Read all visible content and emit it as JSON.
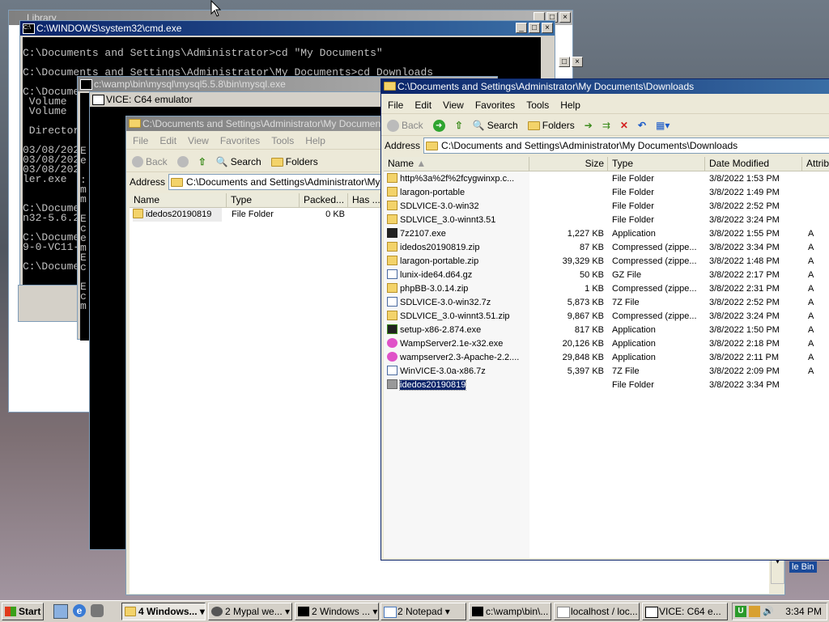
{
  "windows": {
    "library": {
      "title": "Library"
    },
    "cmd": {
      "title": "C:\\WINDOWS\\system32\\cmd.exe",
      "lines": [
        "C:\\Documents and Settings\\Administrator>cd \"My Documents\"",
        "",
        "C:\\Documents and Settings\\Administrator\\My Documents>cd Downloads",
        "",
        "C:\\Docume",
        " Volume ",
        " Volume ",
        "",
        " Director",
        "",
        "03/08/202",
        "03/08/202",
        "03/08/202",
        "ler.exe",
        "",
        "",
        "C:\\Docume",
        "n32-5.6.2",
        "",
        "C:\\Docume",
        "9-0-VC11-",
        "",
        "C:\\Docume"
      ]
    },
    "mysql": {
      "title": "c:\\wamp\\bin\\mysql\\mysql5.5.8\\bin\\mysql.exe",
      "lines": [
        "",
        "",
        "",
        "",
        "",
        "E",
        "e",
        "",
        ":",
        "m",
        "m",
        "",
        "E",
        "c",
        "e",
        "m",
        "E",
        "c",
        "",
        "E",
        "c",
        "m"
      ]
    },
    "vice": {
      "title": "VICE: C64 emulator"
    },
    "explorer_left": {
      "title": "C:\\Documents and Settings\\Administrator\\My Documents",
      "menu": [
        "File",
        "Edit",
        "View",
        "Favorites",
        "Tools",
        "Help"
      ],
      "toolbar": {
        "back": "Back",
        "search": "Search",
        "folders": "Folders"
      },
      "address_label": "Address",
      "address": "C:\\Documents and Settings\\Administrator\\My Documents",
      "columns": [
        "Name",
        "Type",
        "Packed...",
        "Has ..."
      ],
      "rows": [
        {
          "name": "idedos20190819",
          "type": "File Folder",
          "packed": "0 KB"
        }
      ]
    },
    "explorer_right": {
      "title": "C:\\Documents and Settings\\Administrator\\My Documents\\Downloads",
      "menu": [
        "File",
        "Edit",
        "View",
        "Favorites",
        "Tools",
        "Help"
      ],
      "toolbar": {
        "back": "Back",
        "search": "Search",
        "folders": "Folders"
      },
      "address_label": "Address",
      "address": "C:\\Documents and Settings\\Administrator\\My Documents\\Downloads",
      "columns": [
        "Name",
        "Size",
        "Type",
        "Date Modified",
        "Attribu"
      ],
      "rows": [
        {
          "name": "http%3a%2f%2fcygwinxp.c...",
          "size": "",
          "type": "File Folder",
          "date": "3/8/2022 1:53 PM",
          "attr": "",
          "icon": "folder"
        },
        {
          "name": "laragon-portable",
          "size": "",
          "type": "File Folder",
          "date": "3/8/2022 1:49 PM",
          "attr": "",
          "icon": "folder"
        },
        {
          "name": "SDLVICE-3.0-win32",
          "size": "",
          "type": "File Folder",
          "date": "3/8/2022 2:52 PM",
          "attr": "",
          "icon": "folder"
        },
        {
          "name": "SDLVICE_3.0-winnt3.51",
          "size": "",
          "type": "File Folder",
          "date": "3/8/2022 3:24 PM",
          "attr": "",
          "icon": "folder"
        },
        {
          "name": "7z2107.exe",
          "size": "1,227 KB",
          "type": "Application",
          "date": "3/8/2022 1:55 PM",
          "attr": "A",
          "icon": "7z"
        },
        {
          "name": "idedos20190819.zip",
          "size": "87 KB",
          "type": "Compressed (zippe...",
          "date": "3/8/2022 3:34 PM",
          "attr": "A",
          "icon": "zip"
        },
        {
          "name": "laragon-portable.zip",
          "size": "39,329 KB",
          "type": "Compressed (zippe...",
          "date": "3/8/2022 1:48 PM",
          "attr": "A",
          "icon": "zip"
        },
        {
          "name": "lunix-ide64.d64.gz",
          "size": "50 KB",
          "type": "GZ File",
          "date": "3/8/2022 2:17 PM",
          "attr": "A",
          "icon": "file"
        },
        {
          "name": "phpBB-3.0.14.zip",
          "size": "1 KB",
          "type": "Compressed (zippe...",
          "date": "3/8/2022 2:31 PM",
          "attr": "A",
          "icon": "zip"
        },
        {
          "name": "SDLVICE-3.0-win32.7z",
          "size": "5,873 KB",
          "type": "7Z File",
          "date": "3/8/2022 2:52 PM",
          "attr": "A",
          "icon": "file"
        },
        {
          "name": "SDLVICE_3.0-winnt3.51.zip",
          "size": "9,867 KB",
          "type": "Compressed (zippe...",
          "date": "3/8/2022 3:24 PM",
          "attr": "A",
          "icon": "zip"
        },
        {
          "name": "setup-x86-2.874.exe",
          "size": "817 KB",
          "type": "Application",
          "date": "3/8/2022 1:50 PM",
          "attr": "A",
          "icon": "app"
        },
        {
          "name": "WampServer2.1e-x32.exe",
          "size": "20,126 KB",
          "type": "Application",
          "date": "3/8/2022 2:18 PM",
          "attr": "A",
          "icon": "wamp"
        },
        {
          "name": "wampserver2.3-Apache-2.2....",
          "size": "29,848 KB",
          "type": "Application",
          "date": "3/8/2022 2:11 PM",
          "attr": "A",
          "icon": "wamp"
        },
        {
          "name": "WinVICE-3.0a-x86.7z",
          "size": "5,397 KB",
          "type": "7Z File",
          "date": "3/8/2022 2:09 PM",
          "attr": "A",
          "icon": "file"
        },
        {
          "name": "idedos20190819",
          "size": "",
          "type": "File Folder",
          "date": "3/8/2022 3:34 PM",
          "attr": "",
          "icon": "folder-gray",
          "selected": true
        }
      ]
    }
  },
  "desktop": {
    "recycle_bin_fragment": "le Bin"
  },
  "taskbar": {
    "start": "Start",
    "tasks": [
      "4 Windows...",
      "2 Mypal we...",
      "2 Windows ...",
      "2 Notepad",
      "c:\\wamp\\bin\\...",
      "localhost / loc...",
      "VICE: C64 e..."
    ],
    "clock": "3:34 PM"
  }
}
